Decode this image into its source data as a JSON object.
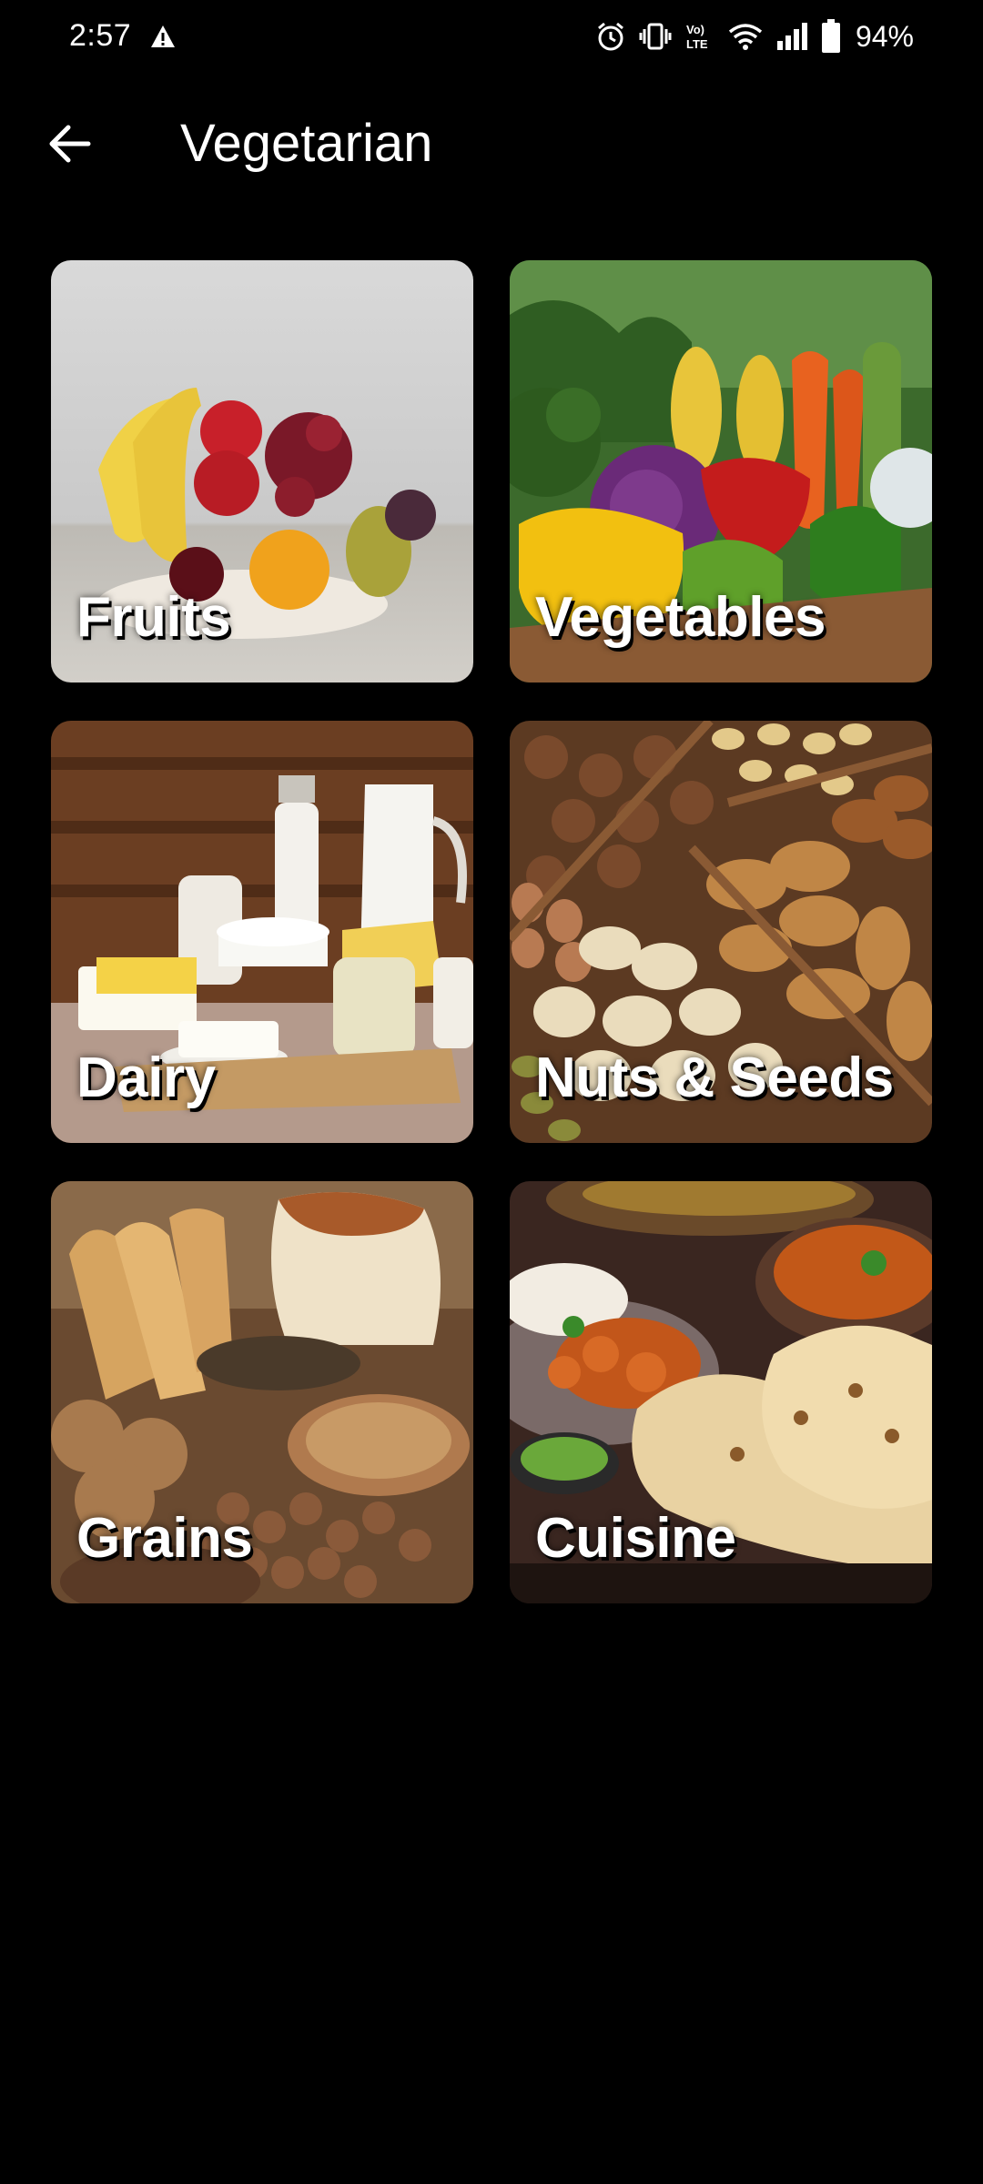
{
  "status_bar": {
    "time": "2:57",
    "battery_percent": "94%",
    "icons": [
      "warning-icon",
      "alarm-icon",
      "vibrate-icon",
      "volte-icon",
      "wifi-icon",
      "signal-icon",
      "battery-icon"
    ]
  },
  "header": {
    "title": "Vegetarian",
    "back_icon": "arrow-back-icon"
  },
  "categories": [
    {
      "label": "Fruits"
    },
    {
      "label": "Vegetables"
    },
    {
      "label": "Dairy"
    },
    {
      "label": "Nuts & Seeds"
    },
    {
      "label": "Grains"
    },
    {
      "label": "Cuisine"
    }
  ],
  "colors": {
    "background": "#000000",
    "text": "#ffffff"
  }
}
